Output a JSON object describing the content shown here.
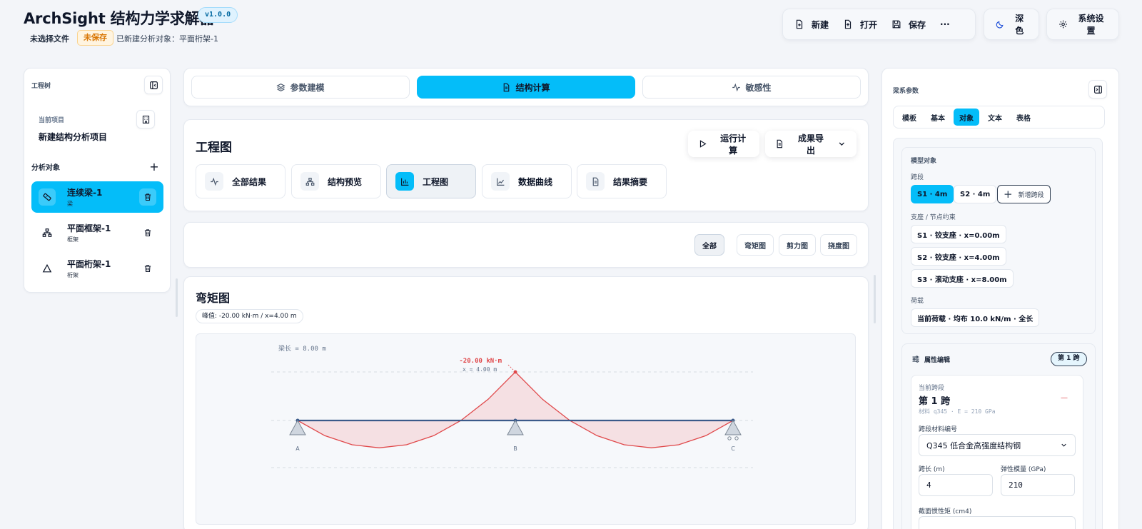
{
  "header": {
    "app_title": "ArchSight 结构力学求解器",
    "version": "v1.0.0",
    "file_label": "未选择文件",
    "unsaved_badge": "未保存",
    "created_info": "已新建分析对象：平面桁架-1",
    "toolbar": {
      "new": "新建",
      "open": "打开",
      "save": "保存",
      "more": "···",
      "theme": "深色",
      "settings": "系统设置"
    }
  },
  "left": {
    "tree_title": "工程树",
    "project_label": "当前项目",
    "project_name": "新建结构分析项目",
    "analysis_label": "分析对象",
    "objects": [
      {
        "name": "连续梁-1",
        "type": "梁",
        "icon": "beam-icon"
      },
      {
        "name": "平面框架-1",
        "type": "框架",
        "icon": "frame-icon"
      },
      {
        "name": "平面桁架-1",
        "type": "桁架",
        "icon": "truss-icon"
      }
    ]
  },
  "main": {
    "segments": [
      "参数建模",
      "结构计算",
      "敏感性"
    ],
    "title": "工程图",
    "run_label": "运行计算",
    "export_label": "成果导出",
    "result_tabs": [
      "全部结果",
      "结构预览",
      "工程图",
      "数据曲线",
      "结果摘要"
    ],
    "filters": [
      "全部",
      "弯矩图",
      "剪力图",
      "挠度图"
    ],
    "diagram_title": "弯矩图",
    "peak_text": "峰值: -20.00 kN·m / x=4.00 m"
  },
  "chart_data": {
    "type": "line",
    "title": "弯矩图",
    "beam_length_text": "梁长 = 8.00 m",
    "peak_label": "-20.00 kN·m",
    "peak_x_label": "x = 4.00 m",
    "supports": [
      {
        "label": "A",
        "x": 0,
        "kind": "pin"
      },
      {
        "label": "B",
        "x": 4,
        "kind": "pin"
      },
      {
        "label": "C",
        "x": 8,
        "kind": "roller"
      }
    ],
    "x": [
      0,
      0.5,
      1,
      1.5,
      2,
      2.5,
      3,
      3.5,
      4,
      4.5,
      5,
      5.5,
      6,
      6.5,
      7,
      7.5,
      8
    ],
    "moment": [
      0,
      6.25,
      10,
      11.25,
      10,
      6.25,
      0,
      -8.75,
      -20,
      -8.75,
      0,
      6.25,
      10,
      11.25,
      10,
      6.25,
      0
    ],
    "xlim": [
      0,
      8
    ],
    "ylim": [
      -20,
      11.25
    ],
    "colors": {
      "beam": "#3b5a8a",
      "curve": "#e0484a",
      "fill": "#f5d6d8"
    }
  },
  "right": {
    "title": "梁系参数",
    "tabs": [
      "模板",
      "基本",
      "对象",
      "文本",
      "表格"
    ],
    "model_label": "模型对象",
    "span_label": "跨段",
    "spans": [
      "S1 · 4m",
      "S2 · 4m"
    ],
    "add_span": "新增跨段",
    "support_label": "支座 / 节点约束",
    "supports": [
      "S1 · 铰支座 · x=0.00m",
      "S2 · 铰支座 · x=4.00m",
      "S3 · 滚动支座 · x=8.00m"
    ],
    "load_label": "荷载",
    "load": "当前荷载 · 均布 10.0 kN/m · 全长",
    "prop_title": "属性编辑",
    "prop_badge": "第 1 跨",
    "cur_span_label": "当前跨段",
    "cur_span": "第 1 跨",
    "cur_span_dash": "—",
    "material_info": "材料 q345 · E = 210 GPa",
    "material_label": "跨段材料编号",
    "material_value": "Q345 低合金高强度结构钢",
    "length_label": "跨长 (m)",
    "length_value": "4",
    "modulus_label": "弹性模量 (GPa)",
    "modulus_value": "210",
    "inertia_label": "截面惯性矩 (cm4)"
  },
  "colors": {
    "accent": "#04bdf9",
    "warning": "#d97706"
  }
}
